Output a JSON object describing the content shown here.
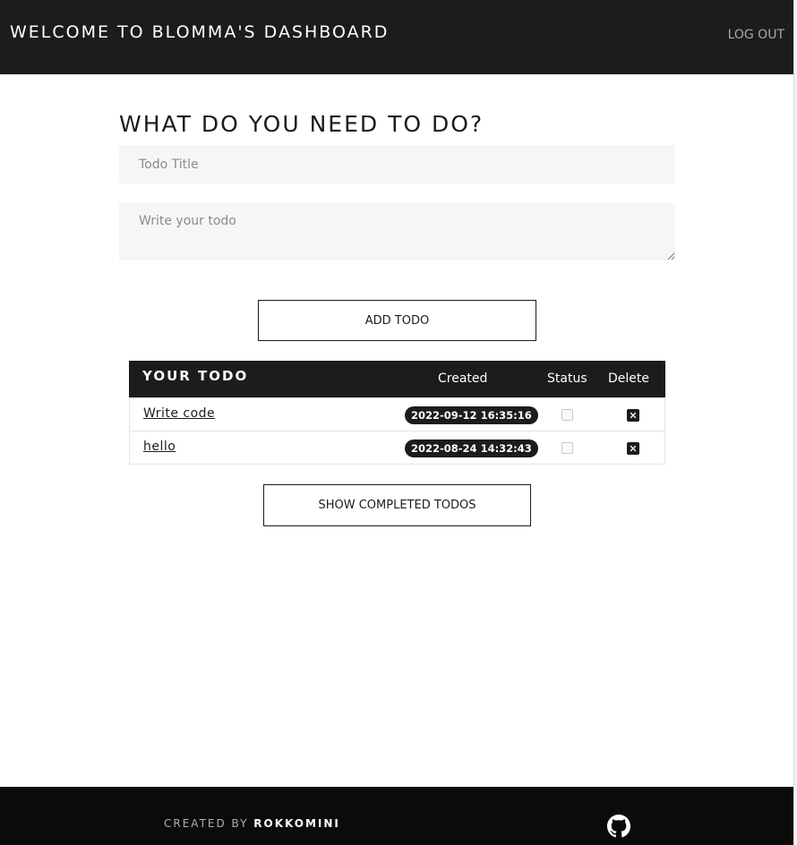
{
  "header": {
    "title": "WELCOME TO BLOMMA'S DASHBOARD",
    "logout_label": "LOG OUT"
  },
  "form": {
    "heading": "WHAT DO YOU NEED TO DO?",
    "title_placeholder": "Todo Title",
    "body_placeholder": "Write your todo",
    "add_label": "ADD TODO"
  },
  "table": {
    "col_title": "YOUR TODO",
    "col_created": "Created",
    "col_status": "Status",
    "col_delete": "Delete",
    "rows": [
      {
        "title": "Write code",
        "created": "2022-09-12 16:35:16"
      },
      {
        "title": "hello",
        "created": "2022-08-24 14:32:43"
      }
    ]
  },
  "show_completed_label": "SHOW COMPLETED TODOS",
  "footer": {
    "prefix": "CREATED BY",
    "author": "ROKKOMINI",
    "icon": "github-icon"
  }
}
